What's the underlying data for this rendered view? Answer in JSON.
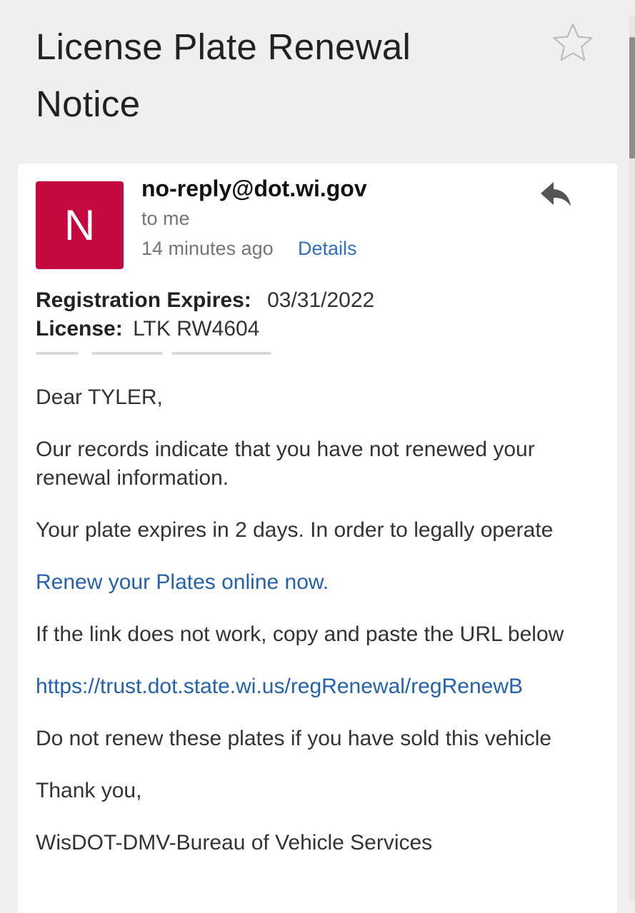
{
  "subject": {
    "line1": "License Plate Renewal",
    "line2": "Notice"
  },
  "icons": {
    "star": "star-outline-icon",
    "reply": "reply-arrow-icon"
  },
  "colors": {
    "avatar_bg": "#c4093f",
    "link": "#2262b0",
    "details_link": "#2f6fc0"
  },
  "message": {
    "avatar_letter": "N",
    "sender": "no-reply@dot.wi.gov",
    "recipient": "to me",
    "time": "14 minutes ago",
    "details_label": "Details"
  },
  "body": {
    "registration_label": "Registration Expires:",
    "registration_value": "03/31/2022",
    "license_label": "License:",
    "license_value": "LTK RW4604",
    "greeting": "Dear TYLER,",
    "para1_line1": "Our records indicate that you have not renewed your",
    "para1_line2": "renewal information.",
    "para2": "Your plate expires in 2 days. In order to legally operate",
    "renew_link": "Renew your Plates online now.",
    "para3": "If the link does not work, copy and paste the URL below",
    "url": "https://trust.dot.state.wi.us/regRenewal/regRenewB",
    "para4": "Do not renew these plates if you have sold this vehicle",
    "closing": "Thank you,",
    "signature": "WisDOT-DMV-Bureau of Vehicle Services"
  }
}
